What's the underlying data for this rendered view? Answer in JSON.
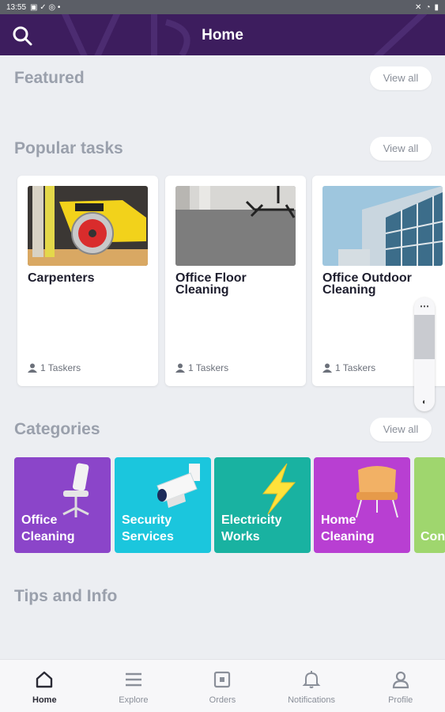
{
  "status_bar": {
    "time": "13:55"
  },
  "app_bar": {
    "title": "Home"
  },
  "sections": {
    "featured": {
      "title": "Featured",
      "view_all": "View all"
    },
    "popular": {
      "title": "Popular tasks",
      "view_all": "View all"
    },
    "categories": {
      "title": "Categories",
      "view_all": "View all"
    },
    "tips": {
      "title": "Tips and Info"
    }
  },
  "popular_tasks": [
    {
      "name": "Carpenters",
      "taskers": "1 Taskers",
      "image": "circular-saw"
    },
    {
      "name": "Office Floor Cleaning",
      "taskers": "1 Taskers",
      "image": "office-floor"
    },
    {
      "name": "Office Outdoor Cleaning",
      "taskers": "1 Taskers",
      "image": "glass-building"
    }
  ],
  "categories": [
    {
      "label": "Office Cleaning",
      "color": "#8b45c9",
      "icon": "office-chair-icon"
    },
    {
      "label": "Security Services",
      "color": "#1bc6dd",
      "icon": "security-camera-icon"
    },
    {
      "label": "Electricity Works",
      "color": "#19b2a1",
      "icon": "lightning-icon"
    },
    {
      "label": "Home Cleaning",
      "color": "#b83fd2",
      "icon": "armchair-icon"
    },
    {
      "label": "Cons",
      "color": "#9fd66e",
      "icon": ""
    }
  ],
  "bottom_nav": [
    {
      "label": "Home",
      "icon": "home-icon",
      "active": true
    },
    {
      "label": "Explore",
      "icon": "menu-icon",
      "active": false
    },
    {
      "label": "Orders",
      "icon": "orders-icon",
      "active": false
    },
    {
      "label": "Notifications",
      "icon": "bell-icon",
      "active": false
    },
    {
      "label": "Profile",
      "icon": "person-icon",
      "active": false
    }
  ],
  "colors": {
    "app_bar": "#3d1d5e",
    "background": "#eceef2",
    "section_title": "#9aa0ac"
  }
}
